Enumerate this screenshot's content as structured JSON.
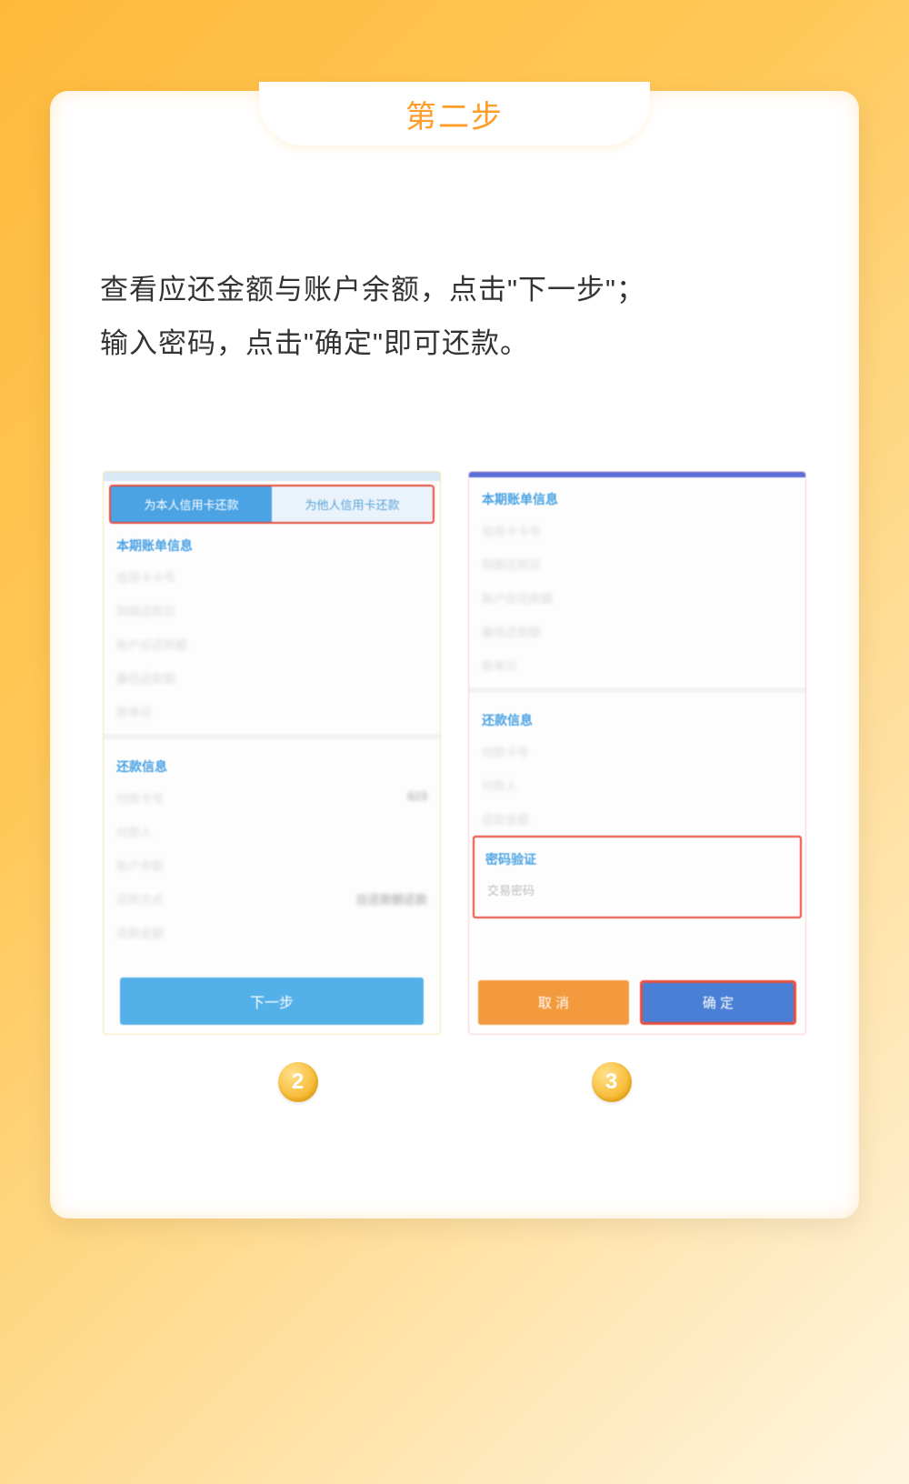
{
  "tab_title": "第二步",
  "instruction_line1": "查看应还金额与账户余额，点击\"下一步\"；",
  "instruction_line2": "输入密码，点击\"确定\"即可还款。",
  "left": {
    "tab_self": "为本人信用卡还款",
    "tab_other": "为他人信用卡还款",
    "section_bill": "本期账单信息",
    "row_cardno": "信用卡卡号",
    "row_due": "到期还款日",
    "row_amount": "账户应还款额",
    "row_min": "最低还款额",
    "row_billday": "账单日",
    "section_repay": "还款信息",
    "row_paycard": "付款卡号",
    "paycard_value": "623",
    "row_payer": "付款人",
    "row_balance": "账户余额",
    "row_method": "还款方式",
    "method_value": "应还款额还款",
    "row_payamt": "还款金额",
    "next_btn": "下一步"
  },
  "right": {
    "section_bill": "本期账单信息",
    "row_cardno": "信用卡卡号",
    "row_due": "到期还款日",
    "row_amount": "账户应还款额",
    "row_min": "最低还款额",
    "row_billday": "账单日",
    "section_repay": "还款信息",
    "row_paycard": "付款卡号",
    "row_payer": "付款人",
    "row_payamt": "还款金额",
    "section_pw": "密码验证",
    "pw_placeholder": "交易密码",
    "cancel_btn": "取 消",
    "confirm_btn": "确 定"
  },
  "badges": {
    "two": "2",
    "three": "3"
  }
}
